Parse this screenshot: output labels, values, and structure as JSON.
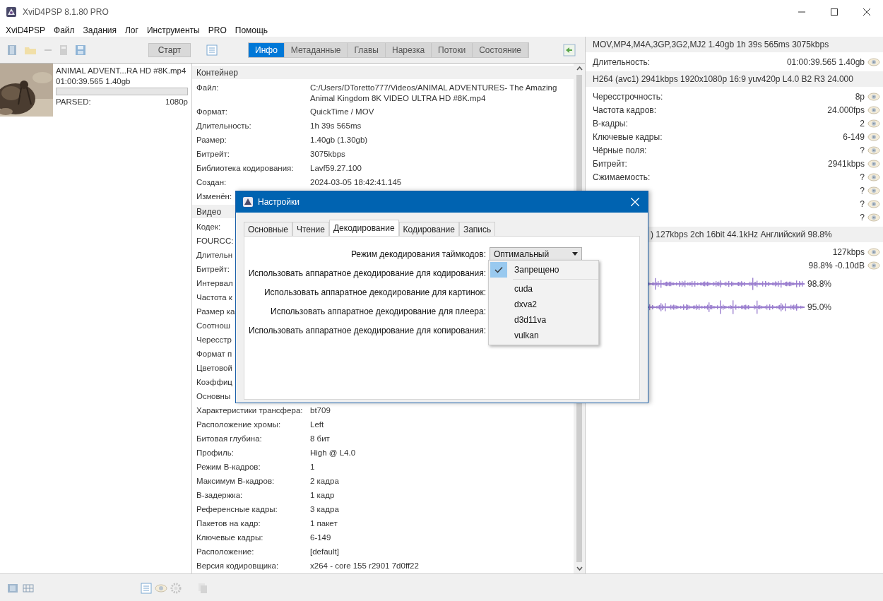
{
  "window": {
    "title": "XviD4PSP 8.1.80 PRO"
  },
  "menu": [
    "XviD4PSP",
    "Файл",
    "Задания",
    "Лог",
    "Инструменты",
    "PRO",
    "Помощь"
  ],
  "toolbar": {
    "start_button": "Старт",
    "tabs": [
      {
        "label": "Инфо",
        "selected": true
      },
      {
        "label": "Метаданные",
        "selected": false
      },
      {
        "label": "Главы",
        "selected": false
      },
      {
        "label": "Нарезка",
        "selected": false
      },
      {
        "label": "Потоки",
        "selected": false
      },
      {
        "label": "Состояние",
        "selected": false
      }
    ]
  },
  "files": [
    {
      "name": "ANIMAL ADVENT...RA HD #8K.mp4",
      "info": "01:00:39.565 1.40gb",
      "level": 0,
      "status": "PARSED:",
      "resolution": "1080p"
    }
  ],
  "info": {
    "sections": [
      {
        "title": "Контейнер",
        "rows": [
          {
            "label": "Файл:",
            "value": "C:/Users/DToretto777/Videos/ANIMAL ADVENTURES- The Amazing Animal Kingdom 8K VIDEO ULTRA HD #8K.mp4"
          },
          {
            "label": "Формат:",
            "value": "QuickTime / MOV"
          },
          {
            "label": "Длительность:",
            "value": "1h 39s 565ms"
          },
          {
            "label": "Размер:",
            "value": "1.40gb (1.30gb)"
          },
          {
            "label": "Битрейт:",
            "value": "3075kbps"
          },
          {
            "label": "Библиотека кодирования:",
            "value": "Lavf59.27.100"
          },
          {
            "label": "Создан:",
            "value": "2024-03-05 18:42:41.145"
          },
          {
            "label": "Изменён:"
          }
        ]
      },
      {
        "title": "Видео",
        "rows": [
          {
            "label": "Кодек:"
          },
          {
            "label": "FOURCC:"
          },
          {
            "label": "Длительн"
          },
          {
            "label": "Битрейт:"
          },
          {
            "label": "Интервал"
          },
          {
            "label": "Частота к"
          },
          {
            "label": "Размер ка"
          },
          {
            "label": "Соотнош"
          },
          {
            "label": "Чересстр"
          },
          {
            "label": "Формат п"
          },
          {
            "label": "Цветовой"
          },
          {
            "label": "Коэффиц"
          },
          {
            "label": "Основны"
          },
          {
            "label": "Характеристики трансфера:",
            "value": "bt709"
          },
          {
            "label": "Расположение хромы:",
            "value": "Left"
          },
          {
            "label": "Битовая глубина:",
            "value": "8 бит"
          },
          {
            "label": "Профиль:",
            "value": "High @ L4.0"
          },
          {
            "label": "Режим B-кадров:",
            "value": "1"
          },
          {
            "label": "Максимум B-кадров:",
            "value": "2 кадра"
          },
          {
            "label": "B-задержка:",
            "value": "1 кадр"
          },
          {
            "label": "Референсные кадры:",
            "value": "3 кадра"
          },
          {
            "label": "Пакетов на кадр:",
            "value": "1 пакет"
          },
          {
            "label": "Ключевые кадры:",
            "value": "6-149"
          },
          {
            "label": "Расположение:",
            "value": "[default]"
          },
          {
            "label": "Версия кодировщика:",
            "value": "x264 - core 155 r2901 7d0ff22"
          }
        ]
      }
    ]
  },
  "summary": {
    "sections": [
      {
        "header": "MOV,MP4,M4A,3GP,3G2,MJ2 1.40gb 1h 39s 565ms 3075kbps",
        "rows": [
          {
            "kind": "text",
            "label": "Длительность:",
            "value": "01:00:39.565 1.40gb"
          }
        ]
      },
      {
        "header": "H264 (avc1) 2941kbps 1920x1080p 16:9 yuv420p L4.0 B2 R3 24.000",
        "rows": [
          {
            "kind": "text",
            "label": "Чересстрочность:",
            "value": "8p"
          },
          {
            "kind": "text",
            "label": "Частота кадров:",
            "value": "24.000fps"
          },
          {
            "kind": "text",
            "label": "B-кадры:",
            "value": "2"
          },
          {
            "kind": "text",
            "label": "Ключевые кадры:",
            "value": "6-149"
          },
          {
            "kind": "text",
            "label": "Чёрные поля:",
            "value": "?"
          },
          {
            "kind": "text",
            "label": "Битрейт:",
            "value": "2941kbps"
          },
          {
            "kind": "text",
            "label": "Сжимаемость:",
            "value": "?"
          },
          {
            "kind": "text",
            "value": "?"
          },
          {
            "kind": "text",
            "value": "?"
          },
          {
            "kind": "text",
            "value": "?"
          }
        ]
      },
      {
        "header": ") 127kbps 2ch 16bit 44.1kHz Английский 98.8%",
        "rows": [
          {
            "kind": "text",
            "value": "127kbps"
          },
          {
            "kind": "text",
            "value": "98.8% -0.10dB"
          },
          {
            "kind": "wave",
            "value": "98.8%"
          },
          {
            "kind": "wave",
            "value": "95.0%"
          }
        ]
      }
    ]
  },
  "dialog": {
    "title": "Настройки",
    "tabs": [
      {
        "label": "Основные",
        "selected": false
      },
      {
        "label": "Чтение",
        "selected": false
      },
      {
        "label": "Декодирование",
        "selected": true
      },
      {
        "label": "Кодирование",
        "selected": false
      },
      {
        "label": "Запись",
        "selected": false
      }
    ],
    "rows": [
      {
        "kind": "combo",
        "label": "Режим декодирования таймкодов:",
        "value": "Оптимальный"
      },
      {
        "kind": "label",
        "label": "Использовать аппаратное декодирование для кодирования:"
      },
      {
        "kind": "label",
        "label": "Использовать аппаратное декодирование для картинок:"
      },
      {
        "kind": "label",
        "label": "Использовать аппаратное декодирование для плеера:"
      },
      {
        "kind": "label",
        "label": "Использовать аппаратное декодирование для копирования:"
      }
    ],
    "dropdown": [
      {
        "label": "Запрещено",
        "selected": true,
        "separator_after": true
      },
      {
        "label": "cuda",
        "selected": false,
        "separator_after": false
      },
      {
        "label": "dxva2",
        "selected": false,
        "separator_after": false
      },
      {
        "label": "d3d11va",
        "selected": false,
        "separator_after": false
      },
      {
        "label": "vulkan",
        "selected": false,
        "separator_after": false
      }
    ]
  }
}
